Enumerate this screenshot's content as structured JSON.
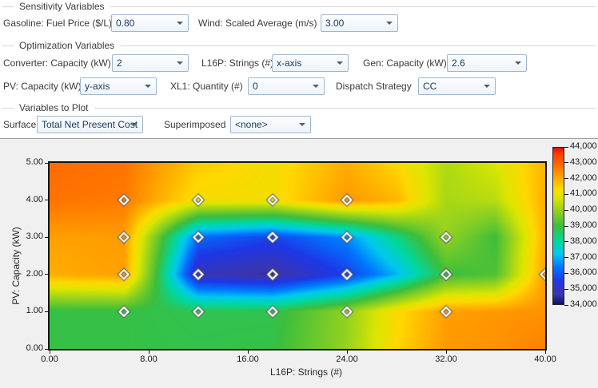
{
  "sensitivity_variables": {
    "title": "Sensitivity Variables",
    "fields": [
      {
        "label": "Gasoline: Fuel Price ($/L)",
        "value": "0.80"
      },
      {
        "label": "Wind: Scaled Average (m/s)",
        "value": "3.00"
      }
    ]
  },
  "optimization_variables": {
    "title": "Optimization Variables",
    "fields": [
      {
        "label": "Converter: Capacity (kW)",
        "value": "2"
      },
      {
        "label": "L16P: Strings (#)",
        "value": "x-axis"
      },
      {
        "label": "Gen: Capacity (kW)",
        "value": "2.6"
      },
      {
        "label": "PV: Capacity (kW)",
        "value": "y-axis"
      },
      {
        "label": "XL1: Quantity (#)",
        "value": "0"
      },
      {
        "label": "Dispatch Strategy",
        "value": "CC"
      }
    ]
  },
  "variables_to_plot": {
    "title": "Variables to Plot",
    "fields": [
      {
        "label": "Surface",
        "value": "Total Net Present Cost"
      },
      {
        "label": "Superimposed",
        "value": "<none>"
      }
    ]
  },
  "chart_data": {
    "type": "heatmap",
    "title": "",
    "xlabel": "L16P: Strings (#)",
    "ylabel": "PV: Capacity (kW)",
    "xlim": [
      0,
      40
    ],
    "ylim": [
      0,
      5
    ],
    "xtick_labels": [
      "0.00",
      "8.00",
      "16.00",
      "24.00",
      "32.00",
      "40.00"
    ],
    "ytick_labels": [
      "0.00",
      "1.00",
      "2.00",
      "3.00",
      "4.00",
      "5.00"
    ],
    "surface_variable": "Total Net Present Cost",
    "grid_x": [
      0,
      6,
      12,
      18,
      24,
      28,
      32,
      36,
      40
    ],
    "grid_y": [
      0,
      1,
      2,
      3,
      4,
      5
    ],
    "values": [
      [
        38900,
        38900,
        38850,
        38900,
        40000,
        41400,
        42300,
        42400,
        42600
      ],
      [
        38900,
        38900,
        38800,
        38800,
        39950,
        41300,
        42200,
        42300,
        42400
      ],
      [
        42000,
        42200,
        34800,
        34450,
        35600,
        37000,
        39000,
        39200,
        42200
      ],
      [
        42200,
        42250,
        36200,
        35700,
        36600,
        38200,
        40000,
        39000,
        42000
      ],
      [
        42800,
        42700,
        41200,
        41200,
        42300,
        41900,
        40200,
        40400,
        42000
      ],
      [
        42900,
        42800,
        41600,
        41200,
        42000,
        41400,
        40300,
        40800,
        41900
      ]
    ],
    "markers": [
      [
        6,
        1
      ],
      [
        12,
        1
      ],
      [
        18,
        1
      ],
      [
        24,
        1
      ],
      [
        32,
        1
      ],
      [
        6,
        2
      ],
      [
        12,
        2
      ],
      [
        18,
        2
      ],
      [
        24,
        2
      ],
      [
        32,
        2
      ],
      [
        40,
        2
      ],
      [
        6,
        3
      ],
      [
        12,
        3
      ],
      [
        18,
        3
      ],
      [
        24,
        3
      ],
      [
        32,
        3
      ],
      [
        6,
        4
      ],
      [
        12,
        4
      ],
      [
        18,
        4
      ],
      [
        24,
        4
      ]
    ],
    "colorbar": {
      "min": 34000,
      "max": 44000,
      "tick_labels": [
        "34,000",
        "35,000",
        "36,000",
        "37,000",
        "38,000",
        "39,000",
        "40,000",
        "41,000",
        "42,000",
        "43,000",
        "44,000"
      ]
    },
    "colormap": [
      {
        "t": 0.0,
        "color": "#101064"
      },
      {
        "t": 0.06,
        "color": "#3c35ad"
      },
      {
        "t": 0.15,
        "color": "#1e37e6"
      },
      {
        "t": 0.24,
        "color": "#0078ff"
      },
      {
        "t": 0.32,
        "color": "#00c8f0"
      },
      {
        "t": 0.4,
        "color": "#00d8a0"
      },
      {
        "t": 0.5,
        "color": "#3cbe3c"
      },
      {
        "t": 0.6,
        "color": "#96d21e"
      },
      {
        "t": 0.68,
        "color": "#dce600"
      },
      {
        "t": 0.74,
        "color": "#ffd800"
      },
      {
        "t": 0.82,
        "color": "#ffa000"
      },
      {
        "t": 0.9,
        "color": "#ff6400"
      },
      {
        "t": 0.96,
        "color": "#ff3c00"
      },
      {
        "t": 1.0,
        "color": "#e10e00"
      }
    ]
  }
}
